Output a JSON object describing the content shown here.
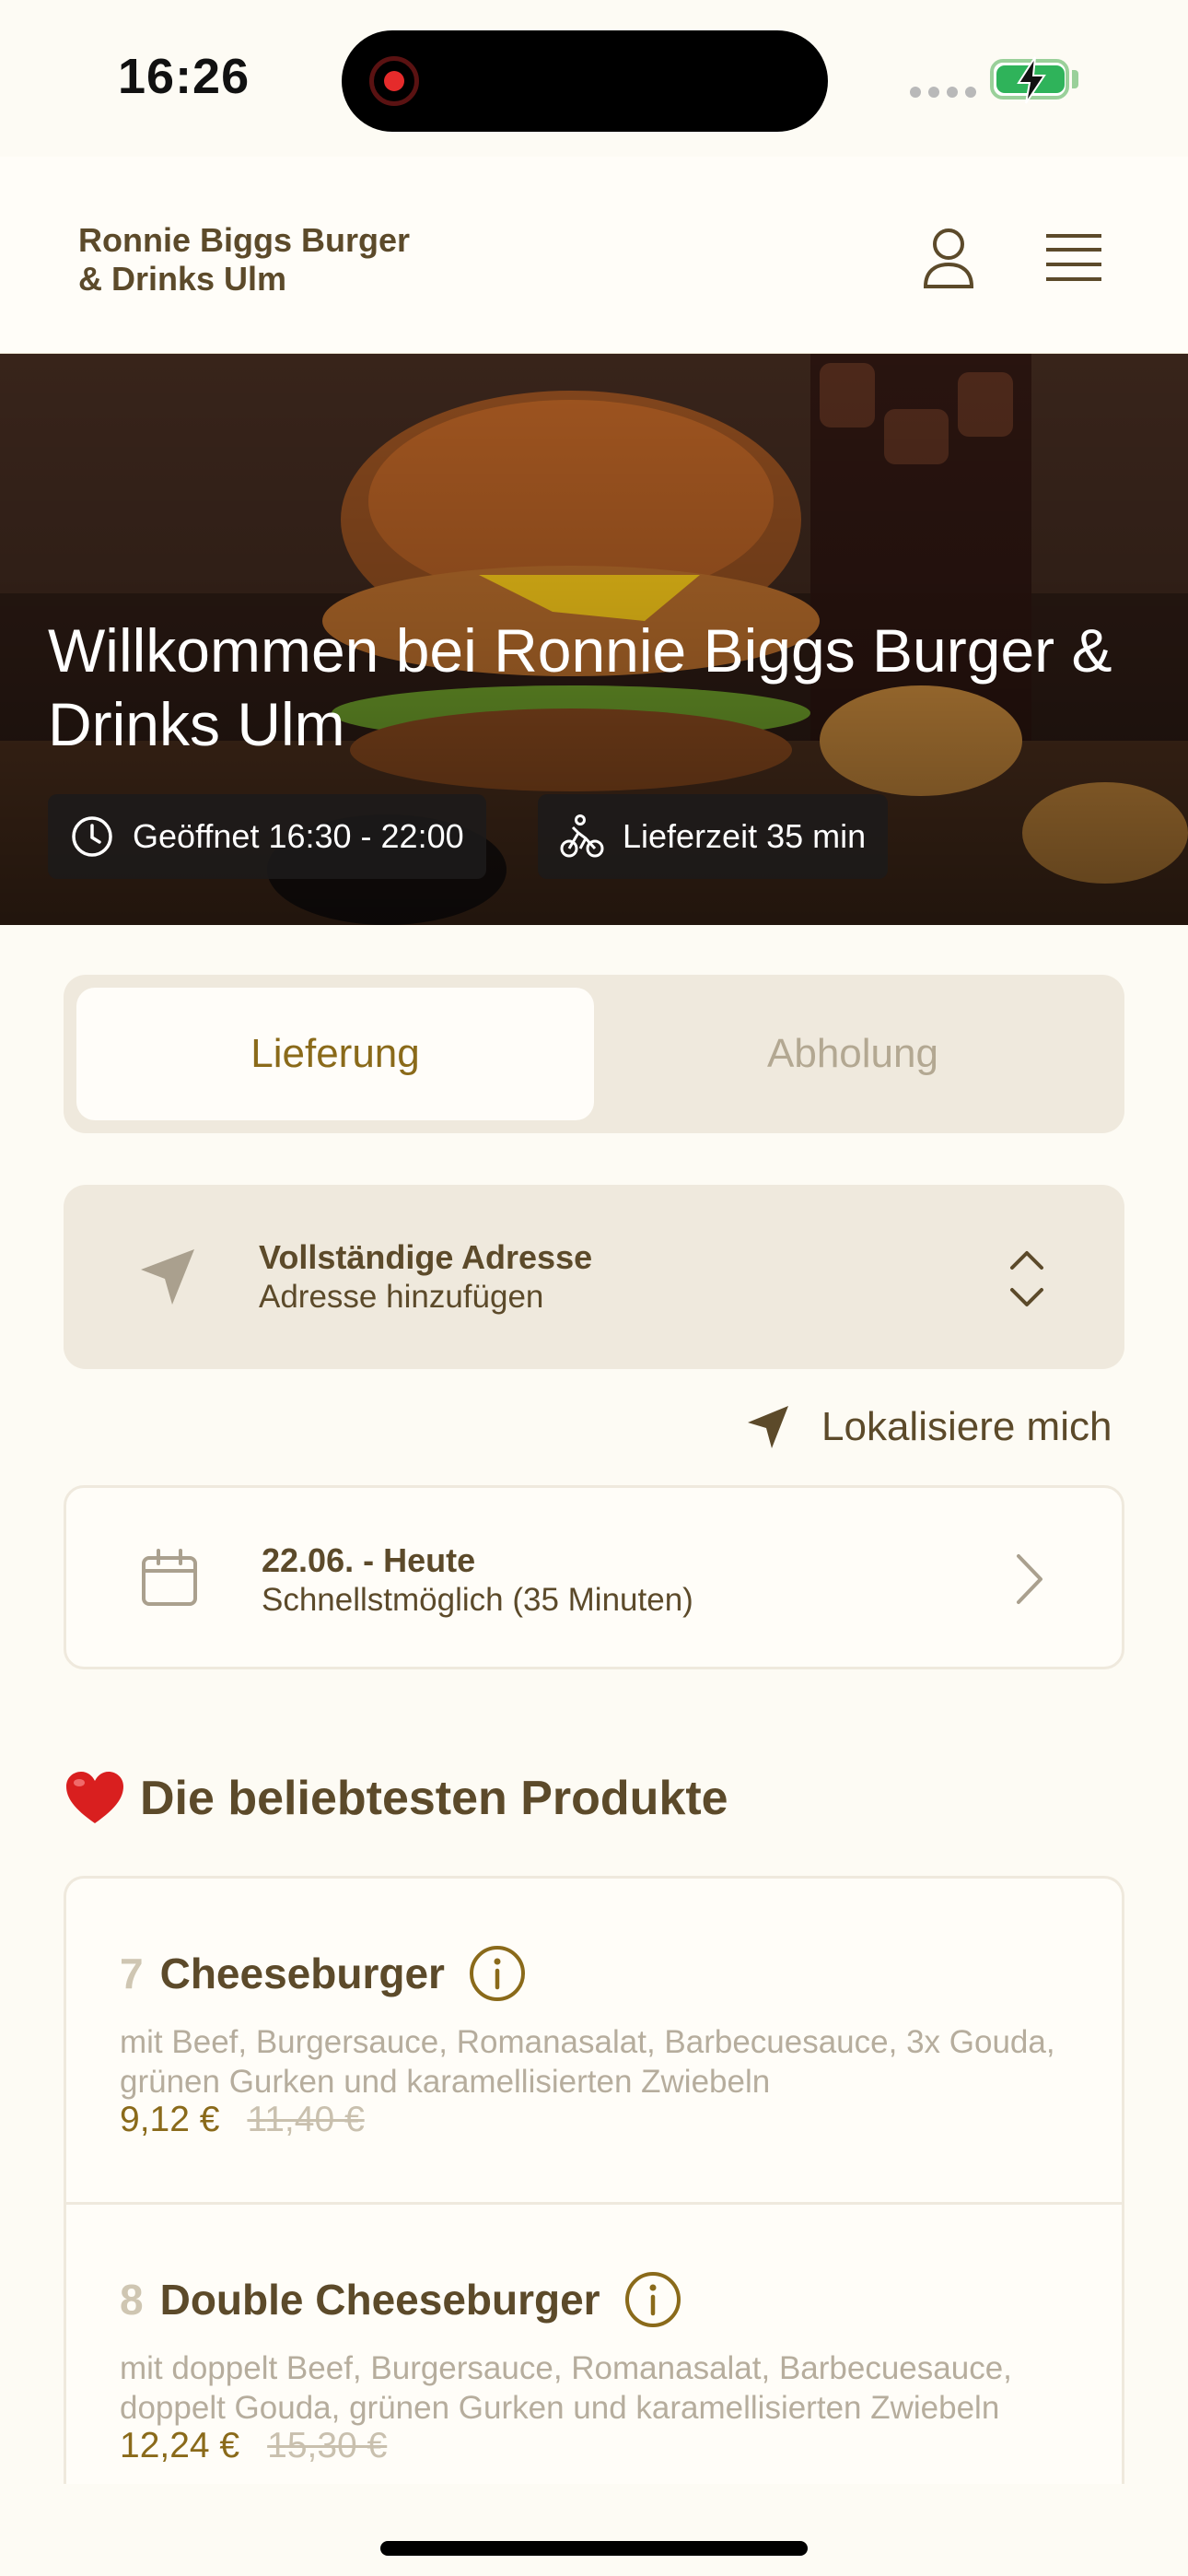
{
  "status_bar": {
    "time": "16:26"
  },
  "header": {
    "brand_line1": "Ronnie Biggs Burger",
    "brand_line2": "& Drinks Ulm",
    "profile_icon": "user-icon",
    "menu_icon": "hamburger-menu-icon"
  },
  "hero": {
    "title": "Willkommen bei Ronnie Biggs Burger & Drinks Ulm",
    "open_hours": "Geöffnet 16:30 - 22:00",
    "delivery_time": "Lieferzeit 35 min"
  },
  "order_mode": {
    "options": [
      "Lieferung",
      "Abholung"
    ],
    "selected": "Lieferung"
  },
  "address": {
    "title": "Vollständige Adresse",
    "subtitle": "Adresse hinzufügen",
    "locate_label": "Lokalisiere mich"
  },
  "schedule": {
    "title": "22.06. - Heute",
    "subtitle": "Schnellstmöglich (35 Minuten)"
  },
  "popular": {
    "heading": "Die beliebtesten Produkte",
    "products": [
      {
        "number": "7",
        "name": "Cheeseburger",
        "description": "mit Beef, Burgersauce, Romanasalat, Barbecuesauce, 3x Gouda, grünen Gurken und karamellisierten Zwiebeln",
        "price": "9,12 €",
        "old_price": "11,40 €"
      },
      {
        "number": "8",
        "name": "Double Cheeseburger",
        "description": "mit doppelt Beef, Burgersauce, Romanasalat, Barbecuesauce, doppelt Gouda, grünen Gurken und karamellisierten Zwiebeln",
        "price": "12,24 €",
        "old_price": "15,30 €"
      }
    ]
  },
  "colors": {
    "background": "#fdfbf4",
    "text_primary": "#5c4a2a",
    "accent_gold": "#8a6a1a",
    "muted": "#b6ad9d",
    "card": "#efe9dd"
  }
}
